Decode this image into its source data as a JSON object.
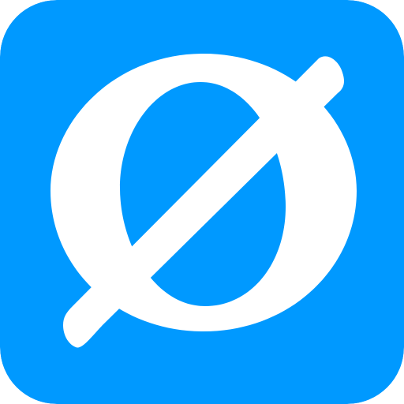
{
  "icon": {
    "name": "slashed-o-logo-icon",
    "background_color": "#0099FF",
    "glyph_color": "#FFFFFF"
  }
}
